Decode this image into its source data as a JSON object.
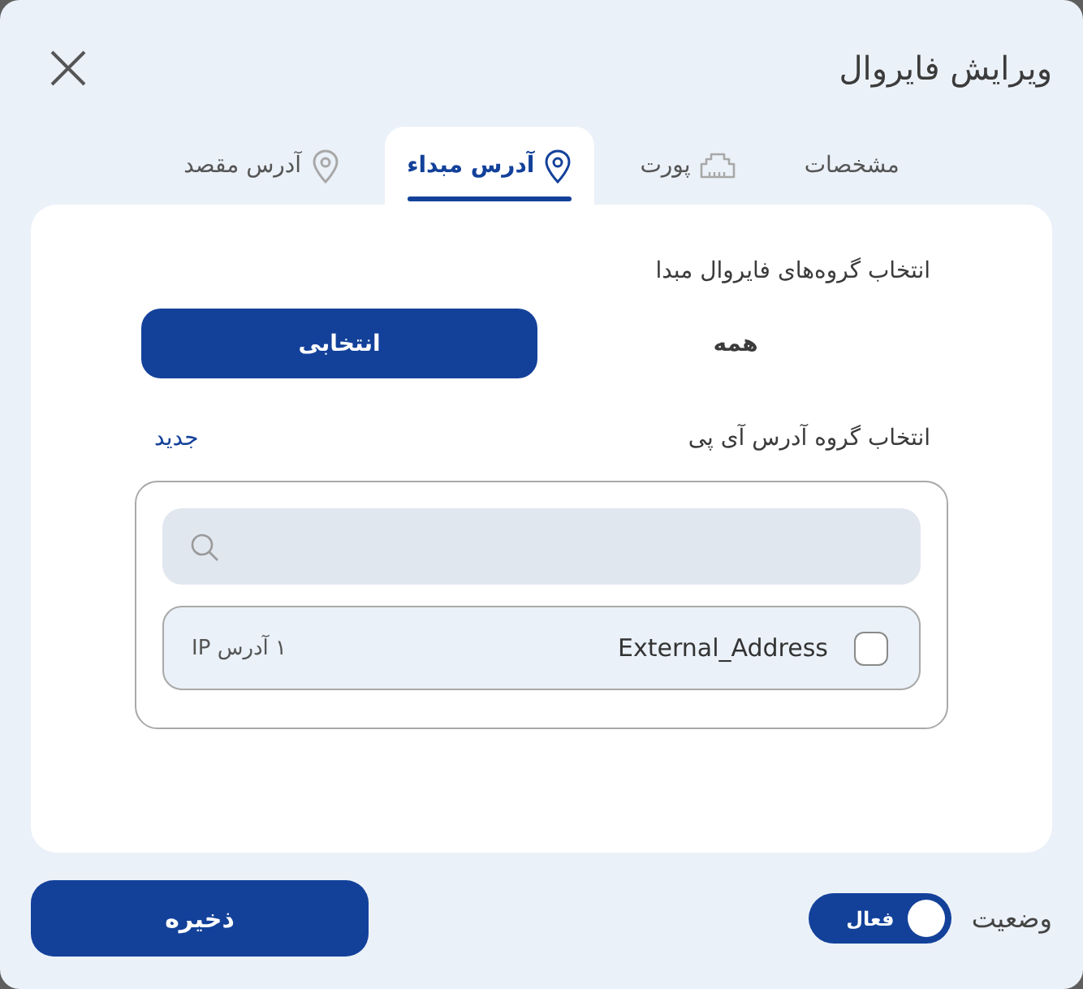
{
  "dialog": {
    "title": "ویرایش فایروال"
  },
  "tabs": [
    {
      "label": "مشخصات",
      "kind": "plain",
      "selected": false
    },
    {
      "label": "پورت",
      "kind": "port",
      "selected": false
    },
    {
      "label": "آدرس مبداء",
      "kind": "address",
      "selected": true
    },
    {
      "label": "آدرس مقصد",
      "kind": "address",
      "selected": false
    }
  ],
  "source_groups": {
    "label": "انتخاب گروه‌های فایروال مبدا",
    "options": [
      {
        "label": "همه",
        "selected": false
      },
      {
        "label": "انتخابی",
        "selected": true
      }
    ]
  },
  "ip_groups": {
    "label": "انتخاب گروه آدرس آی پی",
    "new_link": "جدید",
    "items": [
      {
        "name": "External_Address",
        "count": "۱ آدرس IP",
        "checked": false
      }
    ]
  },
  "footer": {
    "status": {
      "label": "وضعیت",
      "on": true,
      "text": "فعال"
    },
    "save": "ذخیره"
  }
}
